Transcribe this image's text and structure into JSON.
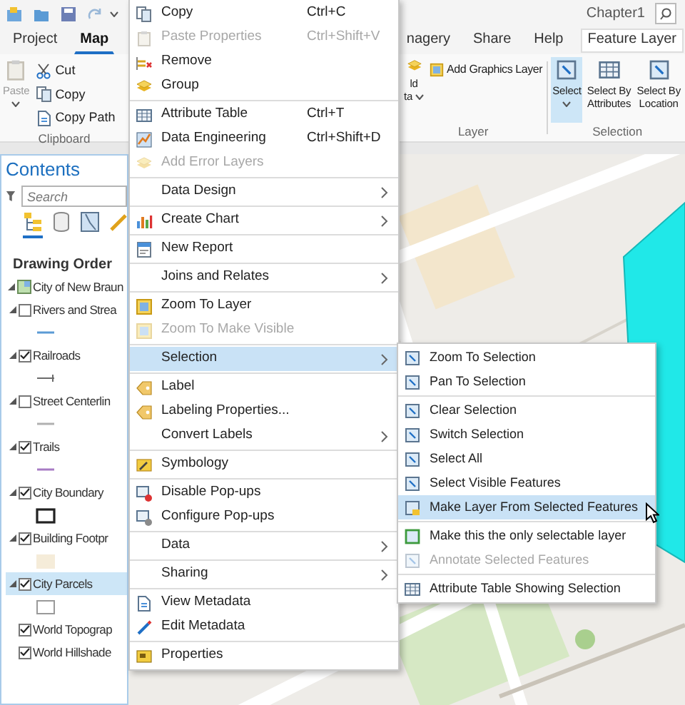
{
  "title_bar": {
    "project": "Chapter1"
  },
  "tabs": [
    {
      "label": "Project",
      "selected": false,
      "kind": "standard"
    },
    {
      "label": "Map",
      "selected": true,
      "kind": "standard"
    },
    {
      "label": "nagery",
      "selected": false,
      "kind": "standard"
    },
    {
      "label": "Share",
      "selected": false,
      "kind": "standard"
    },
    {
      "label": "Help",
      "selected": false,
      "kind": "standard"
    },
    {
      "label": "Feature Layer",
      "selected": false,
      "kind": "contextual"
    }
  ],
  "ribbon": {
    "groups": [
      {
        "label": "Clipboard",
        "buttons": [
          {
            "kind": "large",
            "lines": [
              "Paste"
            ],
            "dropdown": true,
            "disabled": true,
            "selected": false
          },
          {
            "kind": "small",
            "lines": [
              "Cut"
            ],
            "dropdown": false,
            "disabled": false,
            "selected": false
          },
          {
            "kind": "small",
            "lines": [
              "Copy"
            ],
            "dropdown": false,
            "disabled": false,
            "selected": false
          },
          {
            "kind": "small",
            "lines": [
              "Copy Path"
            ],
            "dropdown": false,
            "disabled": false,
            "selected": false
          }
        ]
      },
      {
        "label": "Layer",
        "buttons": [
          {
            "kind": "large",
            "lines": [
              "ld",
              "ta"
            ],
            "dropdown": true,
            "disabled": false,
            "selected": false
          },
          {
            "kind": "small",
            "lines": [
              "Add Graphics Layer"
            ],
            "dropdown": false,
            "disabled": false,
            "selected": false
          }
        ]
      },
      {
        "label": "Selection",
        "buttons": [
          {
            "kind": "large",
            "lines": [
              "Select"
            ],
            "dropdown": true,
            "disabled": false,
            "selected": true
          },
          {
            "kind": "large",
            "lines": [
              "Select By",
              "Attributes"
            ],
            "dropdown": false,
            "disabled": false,
            "selected": false
          },
          {
            "kind": "large",
            "lines": [
              "Select By",
              "Location"
            ],
            "dropdown": false,
            "disabled": false,
            "selected": false
          }
        ]
      }
    ]
  },
  "contents": {
    "title": "Contents",
    "search": {
      "placeholder": "Search"
    },
    "views": [
      {
        "selected": true
      },
      {
        "selected": false
      },
      {
        "selected": false
      },
      {
        "selected": false
      }
    ],
    "heading": "Drawing Order",
    "tree": [
      {
        "label": "City of New Braun",
        "expanded": true,
        "children": [
          {
            "kind": "feature",
            "label": "Rivers and Strea",
            "checked": false,
            "expanded": true,
            "selected": false,
            "symbol": {
              "kind": "line",
              "color": "#5b9bd5"
            }
          },
          {
            "kind": "feature",
            "label": "Railroads",
            "checked": true,
            "expanded": true,
            "selected": false,
            "symbol": {
              "kind": "railroad",
              "color": "#6b6b6b"
            }
          },
          {
            "kind": "feature",
            "label": "Street Centerlin",
            "checked": false,
            "expanded": true,
            "selected": false,
            "symbol": {
              "kind": "line",
              "color": "#b0b0b0"
            }
          },
          {
            "kind": "feature",
            "label": "Trails",
            "checked": true,
            "expanded": true,
            "selected": false,
            "symbol": {
              "kind": "line",
              "color": "#a77bc4"
            }
          },
          {
            "kind": "feature",
            "label": "City Boundary",
            "checked": true,
            "expanded": true,
            "selected": false,
            "symbol": {
              "kind": "outline",
              "color": "#222222"
            }
          },
          {
            "kind": "feature",
            "label": "Building Footpr",
            "checked": true,
            "expanded": true,
            "selected": false,
            "symbol": {
              "kind": "fill",
              "color": "#f5ecd9"
            }
          },
          {
            "kind": "feature",
            "label": "City Parcels",
            "checked": true,
            "expanded": true,
            "selected": true,
            "symbol": {
              "kind": "outline",
              "color": "#9a9a9a"
            }
          },
          {
            "kind": "basemap",
            "label": "World Topograp",
            "checked": true,
            "selected": false
          },
          {
            "kind": "basemap",
            "label": "World Hillshade",
            "checked": true,
            "selected": false
          }
        ]
      }
    ]
  },
  "context_menu": {
    "groups": [
      {
        "items": [
          {
            "label": "Copy",
            "shortcut": "Ctrl+C",
            "disabled": false,
            "selected": false,
            "submenu": false
          },
          {
            "label": "Paste Properties",
            "shortcut": "Ctrl+Shift+V",
            "disabled": true,
            "selected": false,
            "submenu": false
          },
          {
            "label": "Remove",
            "disabled": false,
            "selected": false,
            "submenu": false
          },
          {
            "label": "Group",
            "disabled": false,
            "selected": false,
            "submenu": false
          }
        ]
      },
      {
        "items": [
          {
            "label": "Attribute Table",
            "shortcut": "Ctrl+T",
            "disabled": false,
            "selected": false,
            "submenu": false
          },
          {
            "label": "Data Engineering",
            "shortcut": "Ctrl+Shift+D",
            "disabled": false,
            "selected": false,
            "submenu": false
          },
          {
            "label": "Add Error Layers",
            "disabled": true,
            "selected": false,
            "submenu": false
          }
        ]
      },
      {
        "items": [
          {
            "label": "Data Design",
            "disabled": false,
            "selected": false,
            "submenu": true
          }
        ]
      },
      {
        "items": [
          {
            "label": "Create Chart",
            "disabled": false,
            "selected": false,
            "submenu": true
          }
        ]
      },
      {
        "items": [
          {
            "label": "New Report",
            "disabled": false,
            "selected": false,
            "submenu": false
          }
        ]
      },
      {
        "items": [
          {
            "label": "Joins and Relates",
            "disabled": false,
            "selected": false,
            "submenu": true
          }
        ]
      },
      {
        "items": [
          {
            "label": "Zoom To Layer",
            "disabled": false,
            "selected": false,
            "submenu": false
          },
          {
            "label": "Zoom To Make Visible",
            "disabled": true,
            "selected": false,
            "submenu": false
          }
        ]
      },
      {
        "items": [
          {
            "label": "Selection",
            "disabled": false,
            "selected": true,
            "submenu": true
          }
        ]
      },
      {
        "items": [
          {
            "label": "Label",
            "disabled": false,
            "selected": false,
            "submenu": false
          },
          {
            "label": "Labeling Properties...",
            "disabled": false,
            "selected": false,
            "submenu": false
          },
          {
            "label": "Convert Labels",
            "disabled": false,
            "selected": false,
            "submenu": true
          }
        ]
      },
      {
        "items": [
          {
            "label": "Symbology",
            "disabled": false,
            "selected": false,
            "submenu": false
          }
        ]
      },
      {
        "items": [
          {
            "label": "Disable Pop-ups",
            "disabled": false,
            "selected": false,
            "submenu": false
          },
          {
            "label": "Configure Pop-ups",
            "disabled": false,
            "selected": false,
            "submenu": false
          }
        ]
      },
      {
        "items": [
          {
            "label": "Data",
            "disabled": false,
            "selected": false,
            "submenu": true
          }
        ]
      },
      {
        "items": [
          {
            "label": "Sharing",
            "disabled": false,
            "selected": false,
            "submenu": true
          }
        ]
      },
      {
        "items": [
          {
            "label": "View Metadata",
            "disabled": false,
            "selected": false,
            "submenu": false
          },
          {
            "label": "Edit Metadata",
            "disabled": false,
            "selected": false,
            "submenu": false
          }
        ]
      },
      {
        "items": [
          {
            "label": "Properties",
            "disabled": false,
            "selected": false,
            "submenu": false
          }
        ]
      }
    ]
  },
  "submenu": {
    "groups": [
      {
        "items": [
          {
            "label": "Zoom To Selection",
            "disabled": false,
            "selected": false
          },
          {
            "label": "Pan To Selection",
            "disabled": false,
            "selected": false
          }
        ]
      },
      {
        "items": [
          {
            "label": "Clear Selection",
            "disabled": false,
            "selected": false
          },
          {
            "label": "Switch Selection",
            "disabled": false,
            "selected": false
          },
          {
            "label": "Select All",
            "disabled": false,
            "selected": false
          },
          {
            "label": "Select Visible Features",
            "disabled": false,
            "selected": false
          },
          {
            "label": "Make Layer From Selected Features",
            "disabled": false,
            "selected": true
          }
        ]
      },
      {
        "items": [
          {
            "label": "Make this the only selectable layer",
            "disabled": false,
            "selected": false
          },
          {
            "label": "Annotate Selected Features",
            "disabled": true,
            "selected": false
          }
        ]
      },
      {
        "items": [
          {
            "label": "Attribute Table Showing Selection",
            "disabled": false,
            "selected": false
          }
        ]
      }
    ]
  }
}
